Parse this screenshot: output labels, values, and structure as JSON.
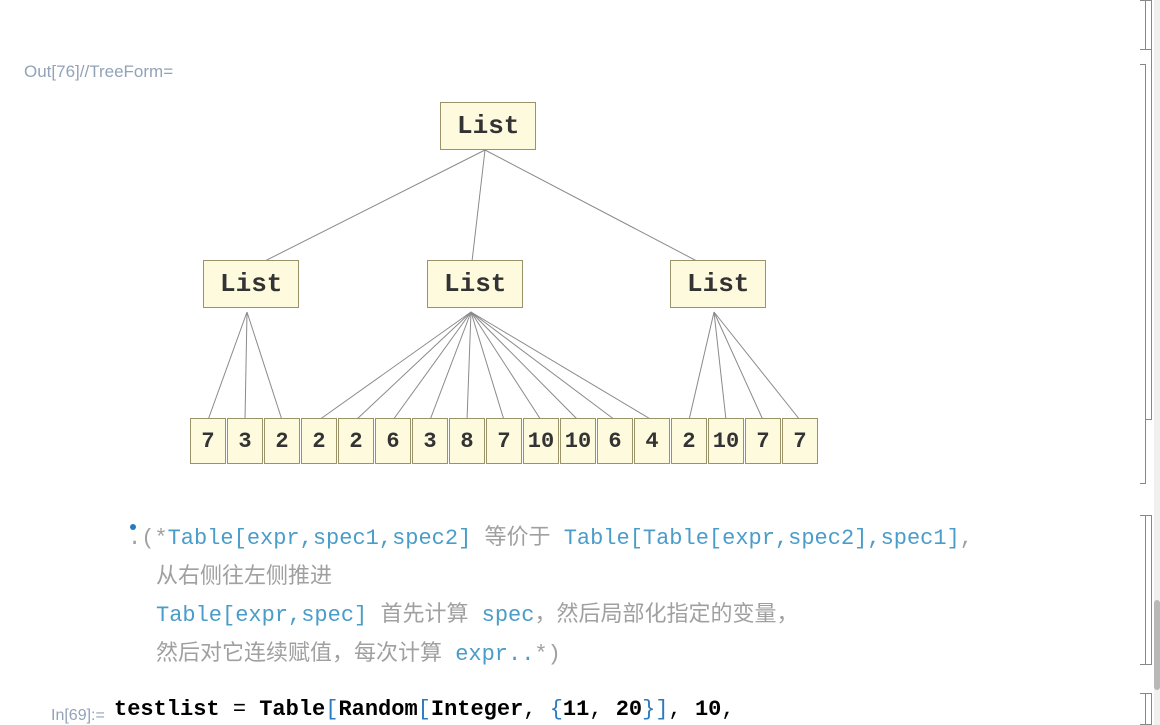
{
  "output_label": "Out[76]//TreeForm=",
  "input_label": "In[69]:=",
  "tree": {
    "root": "List",
    "mids": [
      "List",
      "List",
      "List"
    ],
    "leaves": [
      "7",
      "3",
      "2",
      "2",
      "2",
      "6",
      "3",
      "8",
      "7",
      "10",
      "10",
      "6",
      "4",
      "2",
      "10",
      "7",
      "7"
    ]
  },
  "comment": {
    "line1_pre": ".(*",
    "line1_a": "Table",
    "line1_b": "[",
    "line1_c": "expr",
    "line1_d": ",",
    "line1_e": "spec1",
    "line1_f": ",",
    "line1_g": "spec2",
    "line1_h": "]",
    "line1_mid": " 等价于 ",
    "line1_i": "Table",
    "line1_j": "[",
    "line1_k": "Table",
    "line1_l": "[",
    "line1_m": "expr",
    "line1_n": ",",
    "line1_o": "spec2",
    "line1_p": "]",
    "line1_q": ",",
    "line1_r": "spec1",
    "line1_s": "]",
    "line1_t": ",",
    "line2": "从右侧往左侧推进",
    "line3_a": " Table",
    "line3_b": "[",
    "line3_c": "expr",
    "line3_d": ",",
    "line3_e": "spec",
    "line3_f": "]",
    "line3_g": " 首先计算 ",
    "line3_h": "spec",
    "line3_i": "，然后局部化指定的变量，",
    "line4_a": "然后对它连续赋值，每次计算 ",
    "line4_b": "expr..",
    "line4_c": "*)"
  },
  "code": {
    "a": "testlist",
    "b": " = ",
    "c": "Table",
    "d": "[",
    "e": "Random",
    "f": "[",
    "g": "Integer",
    "h": ", ",
    "i": "{",
    "j": "11",
    "k": ", ",
    "l": "20",
    "m": "}",
    "n": "]",
    "o": ", ",
    "p": "10",
    "q": ","
  }
}
